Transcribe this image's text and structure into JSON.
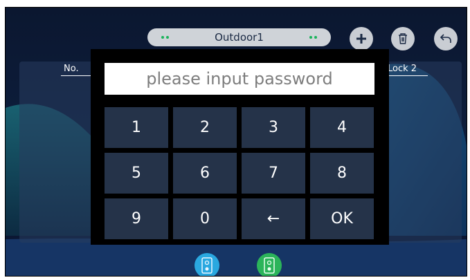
{
  "header": {
    "device_name": "Outdoor1"
  },
  "toolbar": {
    "add_icon": "plus-icon",
    "delete_icon": "trash-icon",
    "back_icon": "back-arrow-icon"
  },
  "table": {
    "col_no": "No.",
    "col_lock2": "Lock 2"
  },
  "keypad": {
    "placeholder": "please input password",
    "keys": [
      "1",
      "2",
      "3",
      "4",
      "5",
      "6",
      "7",
      "8",
      "9",
      "0",
      "←",
      "OK"
    ]
  },
  "bottom_bar": {
    "outdoor1_icon": "outdoor-station-1-icon",
    "outdoor2_icon": "outdoor-station-2-icon"
  },
  "colors": {
    "background": "#0b1730",
    "key_bg": "#253349",
    "outdoor1_accent": "#2aa8e0",
    "outdoor2_accent": "#2bb45a"
  }
}
